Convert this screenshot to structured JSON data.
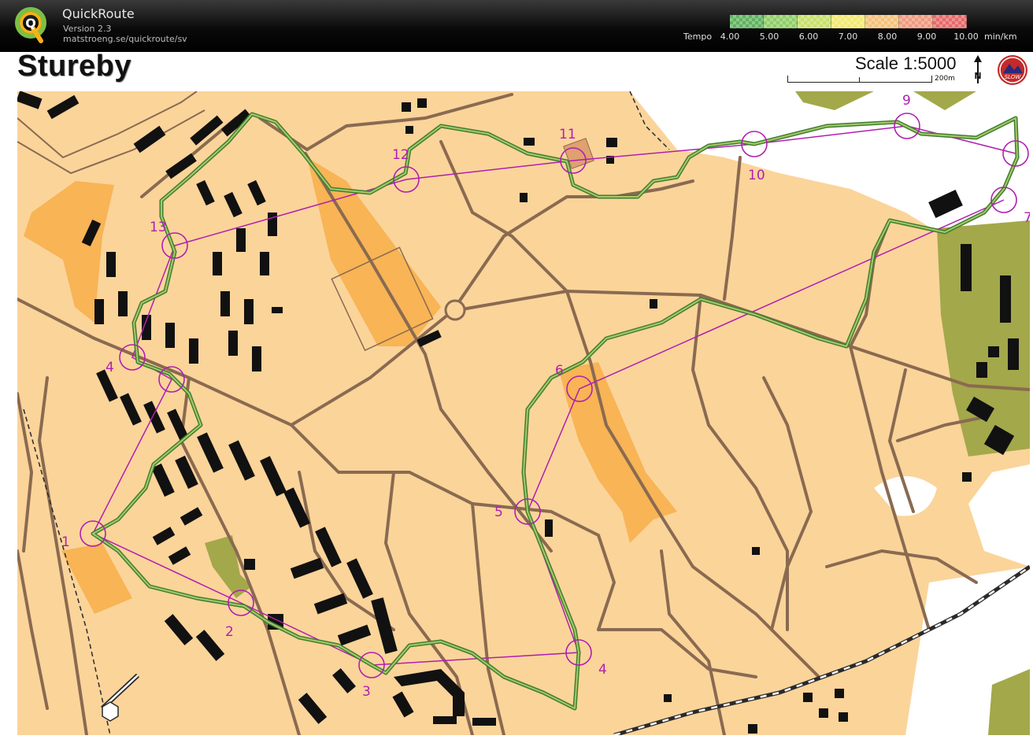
{
  "app": {
    "title": "QuickRoute",
    "version": "Version 2.3",
    "url": "matstroeng.se/quickroute/sv",
    "logo_letter": "Q"
  },
  "tempo": {
    "label": "Tempo",
    "ticks": [
      "4.00",
      "5.00",
      "6.00",
      "7.00",
      "8.00",
      "9.00",
      "10.00"
    ],
    "unit": "min/km",
    "colors": [
      "#5fb35f",
      "#8fcf66",
      "#c8e06a",
      "#f2ea72",
      "#f4c27a",
      "#f09a80",
      "#e86a6a"
    ]
  },
  "map": {
    "title": "Stureby",
    "scale": "Scale 1:5000",
    "scale_distance": "200m",
    "north_letter": "N",
    "club_logo_text": "SLOW",
    "colors": {
      "open_land": "#fbd49a",
      "yellow_area": "#f8b455",
      "forest_green": "#a3a84a",
      "building": "#111111",
      "road": "#8a6a50",
      "course": "#b01fb0",
      "route": "#4e8f3a",
      "railway": "#2a2a2a"
    },
    "controls": [
      {
        "label": "1"
      },
      {
        "label": "2"
      },
      {
        "label": "3"
      },
      {
        "label": "4"
      },
      {
        "label": "5"
      },
      {
        "label": "6"
      },
      {
        "label": "7"
      },
      {
        "label": "9"
      },
      {
        "label": "10"
      },
      {
        "label": "11"
      },
      {
        "label": "12"
      },
      {
        "label": "13"
      },
      {
        "label": "4"
      }
    ]
  }
}
